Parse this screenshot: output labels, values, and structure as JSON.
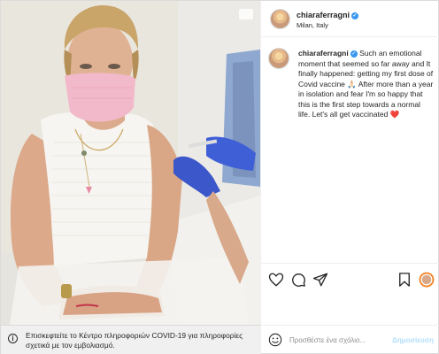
{
  "post": {
    "username": "chiaraferragni",
    "location": "Milan, Italy",
    "caption_username": "chiaraferragni",
    "caption_text": "Such an emotional moment that seemed so far away and It finally happened: getting my first dose of Covid vaccine 🙏🏻 After more than a year in isolation and fear I'm so happy that this is the first step towards a normal life. Let's all get vaccinated",
    "caption_emoji": "❤️"
  },
  "info_bar": {
    "icon": "ⓘ",
    "text": "Επισκεφτείτε το Κέντρο πληροφοριών COVID-19 για πληροφορίες σχετικά με τον εμβολιασμό."
  },
  "comment": {
    "placeholder": "Προσθέστε ένα σχόλιο...",
    "post_label": "Δημοσίευση"
  },
  "colors": {
    "verified": "#3897f0",
    "heart": "#ed4956",
    "post_button_disabled": "#b2dffc",
    "story_ring": "#f58529"
  },
  "icons": [
    "verified-badge-icon",
    "heart-icon",
    "comment-icon",
    "share-icon",
    "bookmark-icon",
    "story-ring-icon",
    "emoji-icon",
    "info-icon"
  ]
}
